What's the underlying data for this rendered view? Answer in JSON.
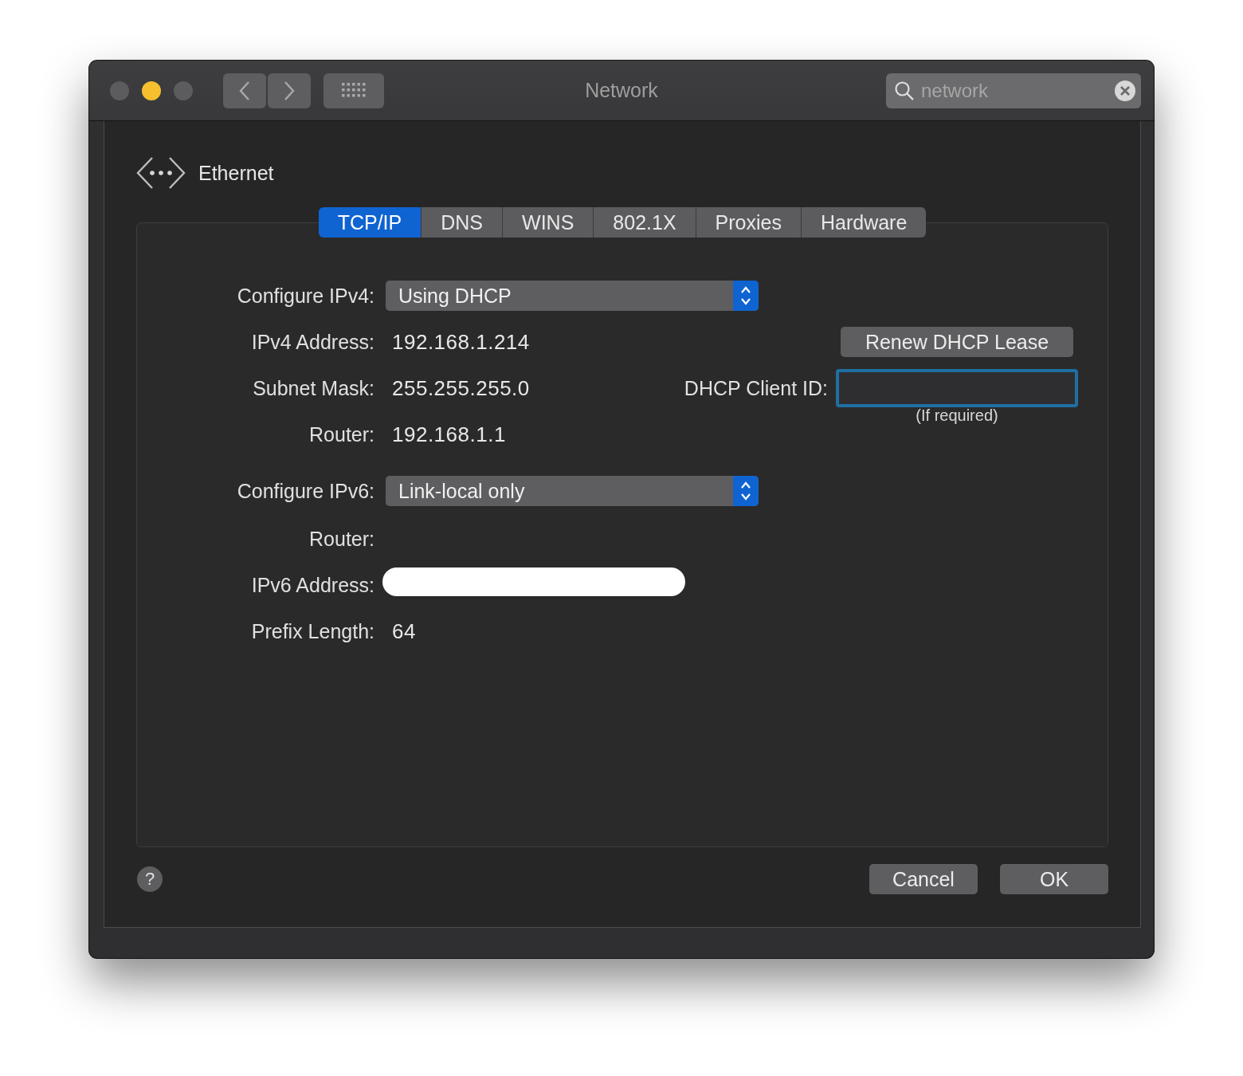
{
  "window": {
    "title": "Network"
  },
  "search": {
    "value": "network"
  },
  "interface": {
    "name": "Ethernet"
  },
  "tabs": [
    {
      "label": "TCP/IP",
      "selected": true
    },
    {
      "label": "DNS",
      "selected": false
    },
    {
      "label": "WINS",
      "selected": false
    },
    {
      "label": "802.1X",
      "selected": false
    },
    {
      "label": "Proxies",
      "selected": false
    },
    {
      "label": "Hardware",
      "selected": false
    }
  ],
  "ipv4": [
    {
      "kind": "popup",
      "label": "Configure IPv4:",
      "value": "Using DHCP"
    },
    {
      "kind": "value",
      "label": "IPv4 Address:",
      "value": "192.168.1.214"
    },
    {
      "kind": "value",
      "label": "Subnet Mask:",
      "value": "255.255.255.0"
    },
    {
      "kind": "value",
      "label": "Router:",
      "value": "192.168.1.1"
    }
  ],
  "renew_button": "Renew DHCP Lease",
  "client_id": {
    "label": "DHCP Client ID:",
    "focused": true,
    "caption": "(If required)"
  },
  "ipv6": [
    {
      "kind": "popup",
      "label": "Configure IPv6:",
      "value": "Link-local only"
    },
    {
      "kind": "empty",
      "label": "Router:"
    },
    {
      "kind": "redacted",
      "label": "IPv6 Address:"
    },
    {
      "kind": "value",
      "label": "Prefix Length:",
      "value": "64"
    }
  ],
  "help_button": "?",
  "buttons": [
    "Cancel",
    "OK"
  ]
}
